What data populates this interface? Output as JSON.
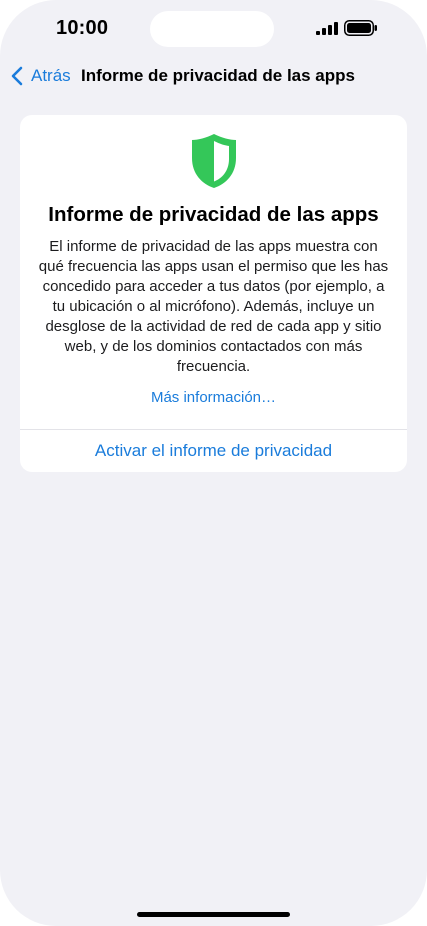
{
  "status_bar": {
    "time": "10:00",
    "signal_icon": "cellular-signal-icon",
    "battery_icon": "battery-icon"
  },
  "nav": {
    "back_label": "Atrás",
    "back_icon": "chevron-left-icon",
    "title": "Informe de privacidad de las apps"
  },
  "card": {
    "icon": "shield-icon",
    "icon_color": "#34c759",
    "title": "Informe de privacidad de las apps",
    "body_lines": [
      "El informe de privacidad de las apps muestra con",
      "qué frecuencia las apps usan el permiso que les has",
      "concedido para acceder a tus datos (por ejemplo, a",
      "tu ubicación o al micrófono). Además, incluye un",
      "desglose de la actividad de red de cada app y sitio",
      "web, y de los dominios contactados con más",
      "frecuencia."
    ],
    "more_link": "Más información…",
    "activate_label": "Activar el informe de privacidad"
  },
  "colors": {
    "accent": "#1a7cdb",
    "background": "#f1f1f6",
    "card": "#ffffff",
    "shield_green": "#34c759"
  }
}
